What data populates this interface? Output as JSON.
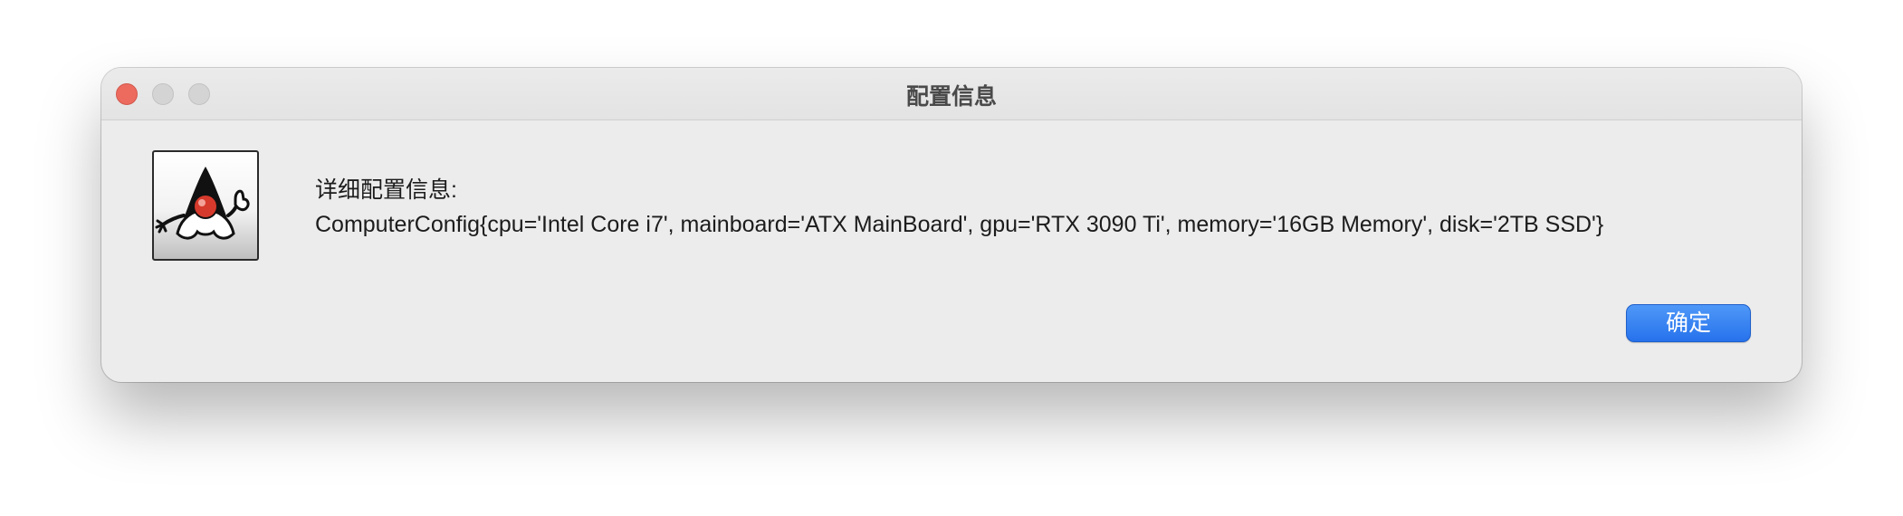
{
  "window": {
    "title": "配置信息"
  },
  "dialog": {
    "icon": "duke-java-mascot-icon",
    "heading": "详细配置信息:",
    "detail": "ComputerConfig{cpu='Intel Core i7', mainboard='ATX MainBoard', gpu='RTX 3090 Ti', memory='16GB Memory', disk='2TB SSD'}",
    "ok_label": "确定"
  },
  "colors": {
    "close_button": "#ed6a5e",
    "inactive_button": "#d4d4d4",
    "accent": "#2772ec"
  }
}
